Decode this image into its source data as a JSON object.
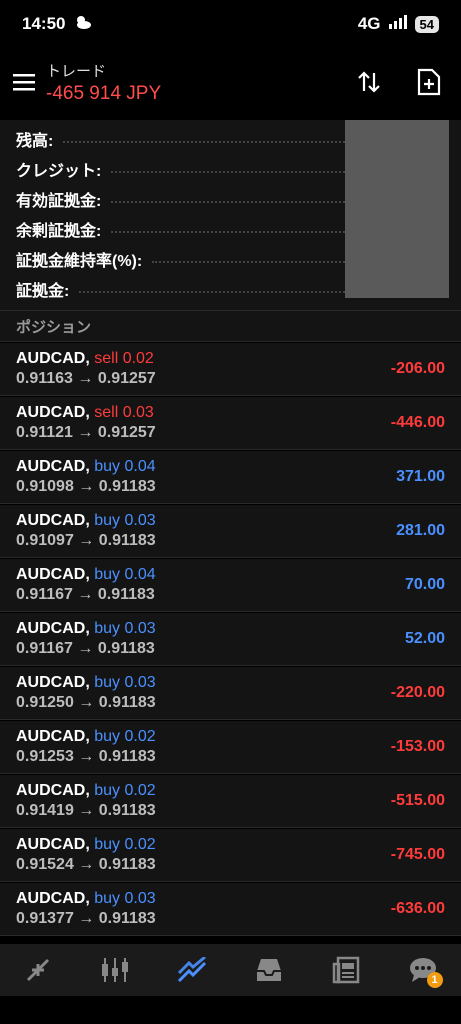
{
  "status_bar": {
    "time": "14:50",
    "network": "4G",
    "battery": "54"
  },
  "header": {
    "title": "トレード",
    "balance": "-465 914 JPY"
  },
  "account": {
    "labels": [
      "残高:",
      "クレジット:",
      "有効証拠金:",
      "余剰証拠金:",
      "証拠金維持率(%):",
      "証拠金:"
    ]
  },
  "section": {
    "title": "ポジション"
  },
  "positions": [
    {
      "symbol": "AUDCAD,",
      "side": "sell 0.02",
      "prices": "0.91163 → 0.91257",
      "profit": "-206.00"
    },
    {
      "symbol": "AUDCAD,",
      "side": "sell 0.03",
      "prices": "0.91121 → 0.91257",
      "profit": "-446.00"
    },
    {
      "symbol": "AUDCAD,",
      "side": "buy 0.04",
      "prices": "0.91098 → 0.91183",
      "profit": "371.00"
    },
    {
      "symbol": "AUDCAD,",
      "side": "buy 0.03",
      "prices": "0.91097 → 0.91183",
      "profit": "281.00"
    },
    {
      "symbol": "AUDCAD,",
      "side": "buy 0.04",
      "prices": "0.91167 → 0.91183",
      "profit": "70.00"
    },
    {
      "symbol": "AUDCAD,",
      "side": "buy 0.03",
      "prices": "0.91167 → 0.91183",
      "profit": "52.00"
    },
    {
      "symbol": "AUDCAD,",
      "side": "buy 0.03",
      "prices": "0.91250 → 0.91183",
      "profit": "-220.00"
    },
    {
      "symbol": "AUDCAD,",
      "side": "buy 0.02",
      "prices": "0.91253 → 0.91183",
      "profit": "-153.00"
    },
    {
      "symbol": "AUDCAD,",
      "side": "buy 0.02",
      "prices": "0.91419 → 0.91183",
      "profit": "-515.00"
    },
    {
      "symbol": "AUDCAD,",
      "side": "buy 0.02",
      "prices": "0.91524 → 0.91183",
      "profit": "-745.00"
    },
    {
      "symbol": "AUDCAD,",
      "side": "buy 0.03",
      "prices": "0.91377 → 0.91183",
      "profit": "-636.00"
    }
  ],
  "nav": {
    "items": [
      "quotes-icon",
      "chart-icon",
      "trade-icon",
      "history-icon",
      "news-icon",
      "messages-icon"
    ],
    "badge": "1"
  },
  "colors": {
    "sell": "#ff3b3b",
    "buy": "#4a90ff",
    "negative": "#ff3b3b",
    "positive": "#4a90ff",
    "active": "#4a90ff"
  }
}
